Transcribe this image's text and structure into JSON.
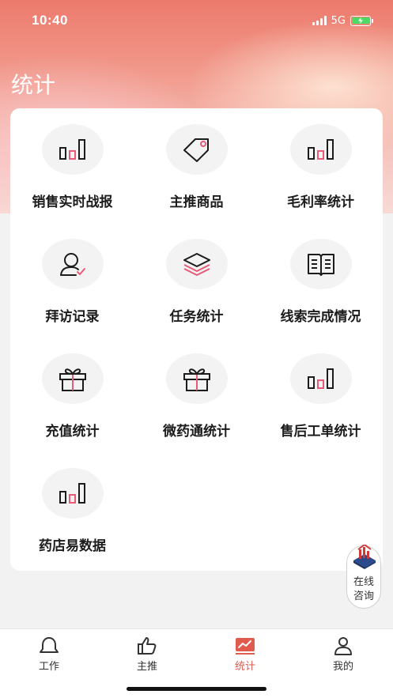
{
  "status": {
    "time": "10:40",
    "network": "5G"
  },
  "page": {
    "title": "统计"
  },
  "tiles": [
    {
      "label": "销售实时战报",
      "icon": "bar-chart-icon"
    },
    {
      "label": "主推商品",
      "icon": "tag-icon"
    },
    {
      "label": "毛利率统计",
      "icon": "bar-chart-icon"
    },
    {
      "label": "拜访记录",
      "icon": "user-check-icon"
    },
    {
      "label": "任务统计",
      "icon": "layers-icon"
    },
    {
      "label": "线索完成情况",
      "icon": "book-icon"
    },
    {
      "label": "充值统计",
      "icon": "gift-icon"
    },
    {
      "label": "微药通统计",
      "icon": "gift-icon"
    },
    {
      "label": "售后工单统计",
      "icon": "bar-chart-icon"
    },
    {
      "label": "药店易数据",
      "icon": "bar-chart-icon"
    }
  ],
  "consult": {
    "line1": "在线",
    "line2": "咨询"
  },
  "tabbar": [
    {
      "label": "工作",
      "icon": "bell-icon"
    },
    {
      "label": "主推",
      "icon": "thumbs-up-icon"
    },
    {
      "label": "统计",
      "icon": "chart-icon",
      "active": true
    },
    {
      "label": "我的",
      "icon": "person-icon"
    }
  ],
  "colors": {
    "accent": "#e05a4e",
    "icon_pink": "#e85a78",
    "hero_top": "#ec7a6c"
  }
}
